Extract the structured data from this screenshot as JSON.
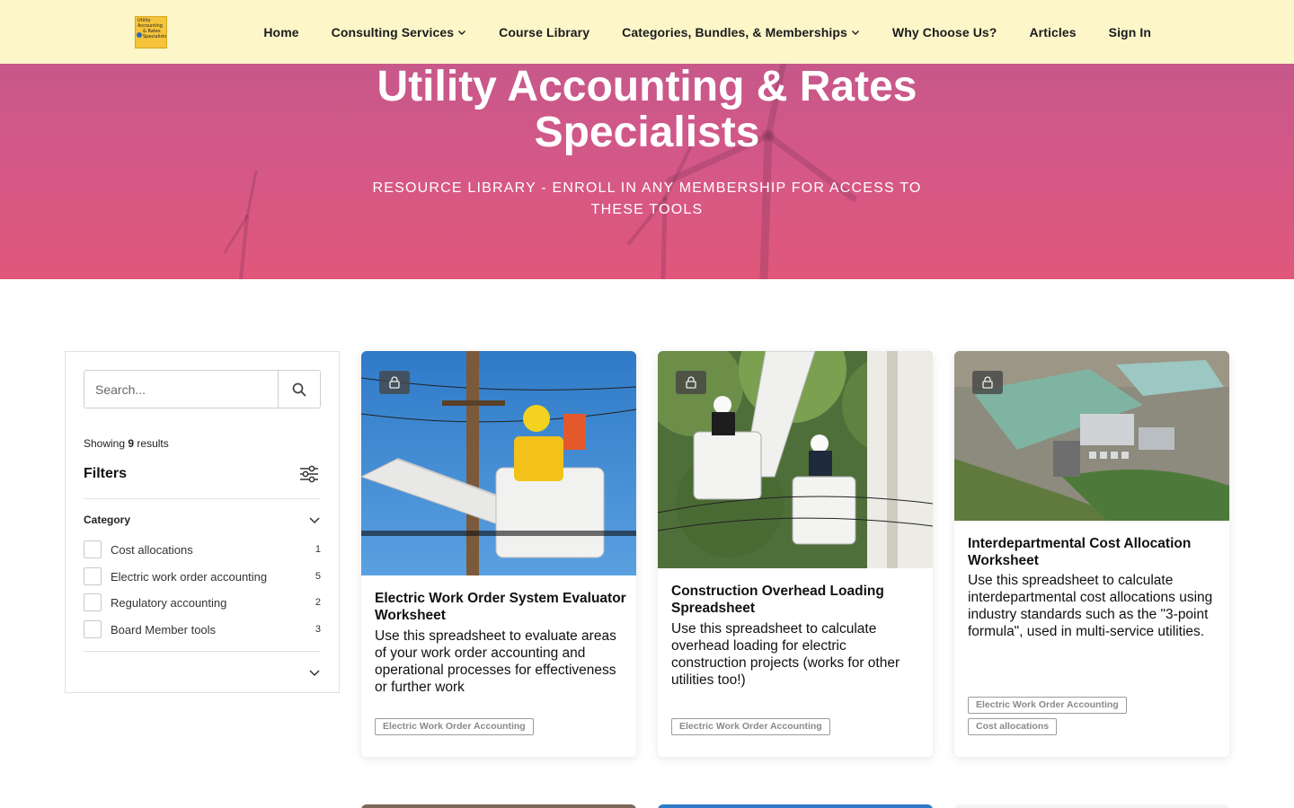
{
  "nav": {
    "logo_lines": [
      "Utility",
      "Accounting",
      "& Rates",
      "Specialists"
    ],
    "items": [
      {
        "label": "Home",
        "dropdown": false
      },
      {
        "label": "Consulting Services",
        "dropdown": true
      },
      {
        "label": "Course Library",
        "dropdown": false
      },
      {
        "label": "Categories, Bundles, & Memberships",
        "dropdown": true
      },
      {
        "label": "Why Choose Us?",
        "dropdown": false
      },
      {
        "label": "Articles",
        "dropdown": false
      },
      {
        "label": "Sign In",
        "dropdown": false
      }
    ],
    "background": "#fcf6c9"
  },
  "hero": {
    "title": "Utility Accounting & Rates Specialists",
    "subtitle": "RESOURCE LIBRARY - ENROLL IN ANY MEMBERSHIP FOR ACCESS TO THESE TOOLS",
    "color": "#d45887"
  },
  "sidebar": {
    "search_placeholder": "Search...",
    "showing_prefix": "Showing",
    "showing_count": "9",
    "showing_suffix": "results",
    "filters_title": "Filters",
    "category_title": "Category",
    "categories": [
      {
        "label": "Cost allocations",
        "count": "1"
      },
      {
        "label": "Electric work order accounting",
        "count": "5"
      },
      {
        "label": "Regulatory accounting",
        "count": "2"
      },
      {
        "label": "Board Member tools",
        "count": "3"
      }
    ]
  },
  "cards": [
    {
      "title": "Electric Work Order System Evaluator Worksheet",
      "description": "Use this spreadsheet to evaluate areas of your work order accounting and operational processes for effectiveness or further work",
      "tags": [
        "Electric Work Order Accounting"
      ],
      "image": "lineman-bucket-truck-icon",
      "locked": true
    },
    {
      "title": "Construction Overhead Loading Spreadsheet",
      "description": "Use this spreadsheet to calculate overhead loading for electric construction projects (works for other utilities too!)",
      "tags": [
        "Electric Work Order Accounting"
      ],
      "image": "two-linemen-bucket-icon",
      "locked": true
    },
    {
      "title": "Interdepartmental Cost Allocation Worksheet",
      "description": "Use this spreadsheet to calculate interdepartmental cost allocations using industry standards such as the \"3-point formula\", used in multi-service utilities.",
      "tags": [
        "Electric Work Order Accounting",
        "Cost allocations"
      ],
      "image": "aerial-plant-icon",
      "locked": true
    }
  ]
}
